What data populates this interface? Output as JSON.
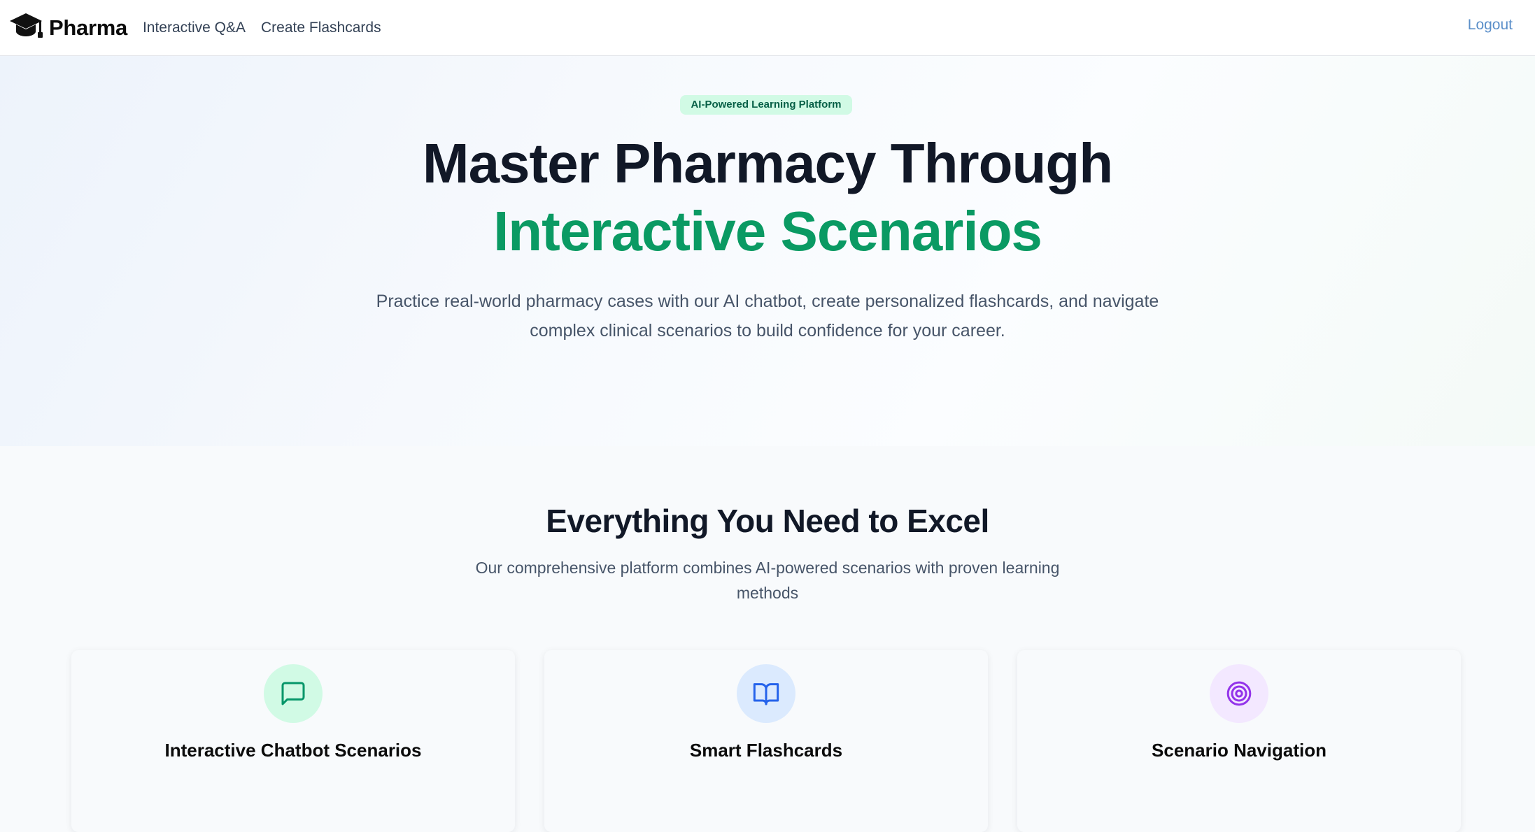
{
  "header": {
    "brand_name": "Pharma",
    "brand_icon": "graduation-cap-icon",
    "nav": [
      {
        "label": "Interactive Q&A"
      },
      {
        "label": "Create Flashcards"
      }
    ],
    "logout_label": "Logout"
  },
  "hero": {
    "badge": "AI-Powered Learning Platform",
    "title_line1": "Master Pharmacy Through",
    "title_line2": "Interactive Scenarios",
    "subtitle": "Practice real-world pharmacy cases with our AI chatbot, create personalized flashcards, and navigate complex clinical scenarios to build confidence for your career."
  },
  "features": {
    "title": "Everything You Need to Excel",
    "subtitle": "Our comprehensive platform combines AI-powered scenarios with proven learning methods",
    "cards": [
      {
        "title": "Interactive Chatbot Scenarios",
        "icon": "message-square-icon",
        "accent": "#059669"
      },
      {
        "title": "Smart Flashcards",
        "icon": "book-open-icon",
        "accent": "#2563eb"
      },
      {
        "title": "Scenario Navigation",
        "icon": "target-icon",
        "accent": "#9333ea"
      }
    ]
  },
  "colors": {
    "accent_green": "#0a9a63",
    "badge_bg": "#d1fae5",
    "logout_link": "#5b8fc9",
    "heading": "#111827",
    "body_text": "#475569"
  }
}
